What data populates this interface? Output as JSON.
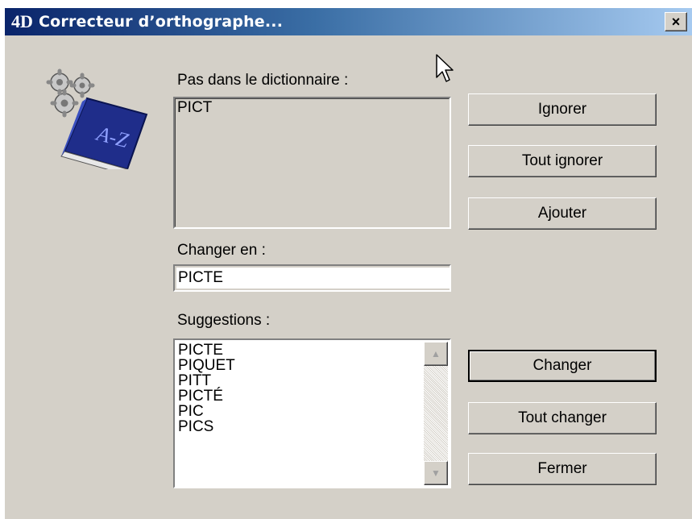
{
  "window": {
    "title": "Correcteur d’orthographe...",
    "logo": "4D",
    "close_glyph": "×"
  },
  "labels": {
    "not_in_dictionary": "Pas dans le dictionnaire :",
    "change_to": "Changer en :",
    "suggestions": "Suggestions :"
  },
  "not_in_dictionary_word": "PICT",
  "change_to_value": "PICTE",
  "suggestions": [
    "PICTE",
    "PIQUET",
    "PITT",
    "PICTÉ",
    "PIC",
    "PICS"
  ],
  "buttons": {
    "ignore": "Ignorer",
    "ignore_all": "Tout ignorer",
    "add": "Ajouter",
    "change": "Changer",
    "change_all": "Tout changer",
    "close": "Fermer"
  },
  "icons": {
    "app_icon": "gears-dictionary-icon",
    "title_logo": "4d-logo-icon",
    "cursor": "mouse-pointer-icon"
  },
  "colors": {
    "titlebar_start": "#0a246a",
    "titlebar_end": "#a6caf0",
    "dialog_bg": "#d4d0c8"
  }
}
